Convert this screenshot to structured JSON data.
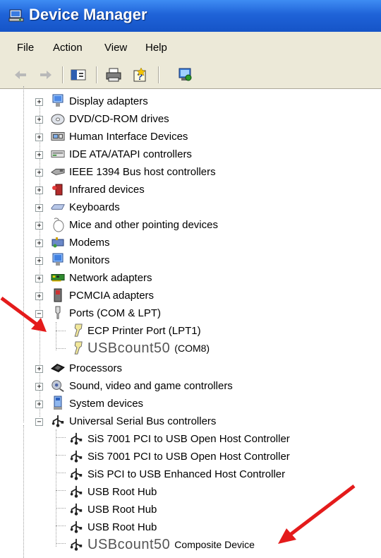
{
  "window": {
    "title": "Device Manager"
  },
  "menu": [
    "File",
    "Action",
    "View",
    "Help"
  ],
  "toolbar": [
    "back-arrow-icon",
    "forward-arrow-icon",
    "show-hide-tree-icon",
    "print-icon",
    "help-icon",
    "scan-hardware-icon"
  ],
  "tree": {
    "categories": [
      {
        "label": "Display adapters",
        "icon": "display-adapter-icon"
      },
      {
        "label": "DVD/CD-ROM drives",
        "icon": "dvd-drive-icon"
      },
      {
        "label": "Human Interface Devices",
        "icon": "hid-icon"
      },
      {
        "label": "IDE ATA/ATAPI controllers",
        "icon": "ide-controller-icon"
      },
      {
        "label": "IEEE 1394 Bus host controllers",
        "icon": "ieee1394-icon"
      },
      {
        "label": "Infrared devices",
        "icon": "infrared-icon"
      },
      {
        "label": "Keyboards",
        "icon": "keyboard-icon"
      },
      {
        "label": "Mice and other pointing devices",
        "icon": "mouse-icon"
      },
      {
        "label": "Modems",
        "icon": "modem-icon"
      },
      {
        "label": "Monitors",
        "icon": "monitor-icon"
      },
      {
        "label": "Network adapters",
        "icon": "network-adapter-icon"
      },
      {
        "label": "PCMCIA adapters",
        "icon": "pcmcia-icon"
      }
    ],
    "ports": {
      "label": "Ports (COM & LPT)",
      "children": [
        {
          "label": "ECP Printer Port (LPT1)"
        },
        {
          "label": "USBcount50",
          "suffix": "(COM8)"
        }
      ]
    },
    "categories_after": [
      {
        "label": "Processors",
        "icon": "processor-icon"
      },
      {
        "label": "Sound, video and game controllers",
        "icon": "sound-icon"
      },
      {
        "label": "System devices",
        "icon": "system-devices-icon"
      }
    ],
    "usb": {
      "label": "Universal Serial Bus controllers",
      "children": [
        {
          "label": "SiS 7001 PCI to USB Open Host Controller"
        },
        {
          "label": "SiS 7001 PCI to USB Open Host Controller"
        },
        {
          "label": "SiS PCI to USB Enhanced Host Controller"
        },
        {
          "label": "USB Root Hub"
        },
        {
          "label": "USB Root Hub"
        },
        {
          "label": "USB Root Hub"
        },
        {
          "label": "USBcount50",
          "suffix": "Composite Device"
        }
      ]
    }
  },
  "colors": {
    "titlebar": "#1f63d8",
    "menubar": "#ece9d8",
    "annotation_arrow": "#e41b1b"
  }
}
